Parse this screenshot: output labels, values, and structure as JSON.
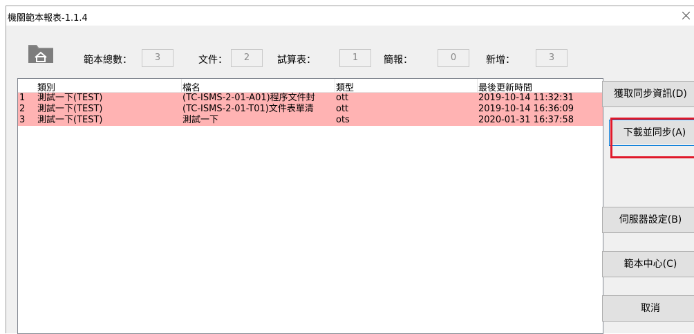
{
  "window": {
    "title": "機關範本報表-1.1.4"
  },
  "stats": [
    {
      "label": "範本總數：",
      "value": "3"
    },
    {
      "label": "文件：",
      "value": "2"
    },
    {
      "label": "試算表：",
      "value": "1"
    },
    {
      "label": "簡報：",
      "value": "0"
    },
    {
      "label": "新增：",
      "value": "3"
    }
  ],
  "table": {
    "columns": [
      "類別",
      "檔名",
      "類型",
      "最後更新時間"
    ],
    "rows": [
      {
        "index": "1",
        "category": "測試一下(TEST)",
        "filename": "(TC-ISMS-2-01-A01)程序文件封",
        "type": "ott",
        "updated": "2019-10-14 11:32:31"
      },
      {
        "index": "2",
        "category": "測試一下(TEST)",
        "filename": "(TC-ISMS-2-01-T01)文件表單清",
        "type": "ott",
        "updated": "2019-10-14 16:36:09"
      },
      {
        "index": "3",
        "category": "測試一下(TEST)",
        "filename": "測試一下",
        "type": "ots",
        "updated": "2020-01-31 16:37:58"
      }
    ],
    "row_highlight_color": "#ffb3b3"
  },
  "buttons": {
    "fetch_sync": "獲取同步資訊(D)",
    "download_sync": "下載並同步(A)",
    "server_settings": "伺服器設定(B)",
    "template_center": "範本中心(C)",
    "cancel": "取消"
  },
  "colors": {
    "highlight_border": "#e0182a",
    "focus_border": "#0078d7"
  }
}
